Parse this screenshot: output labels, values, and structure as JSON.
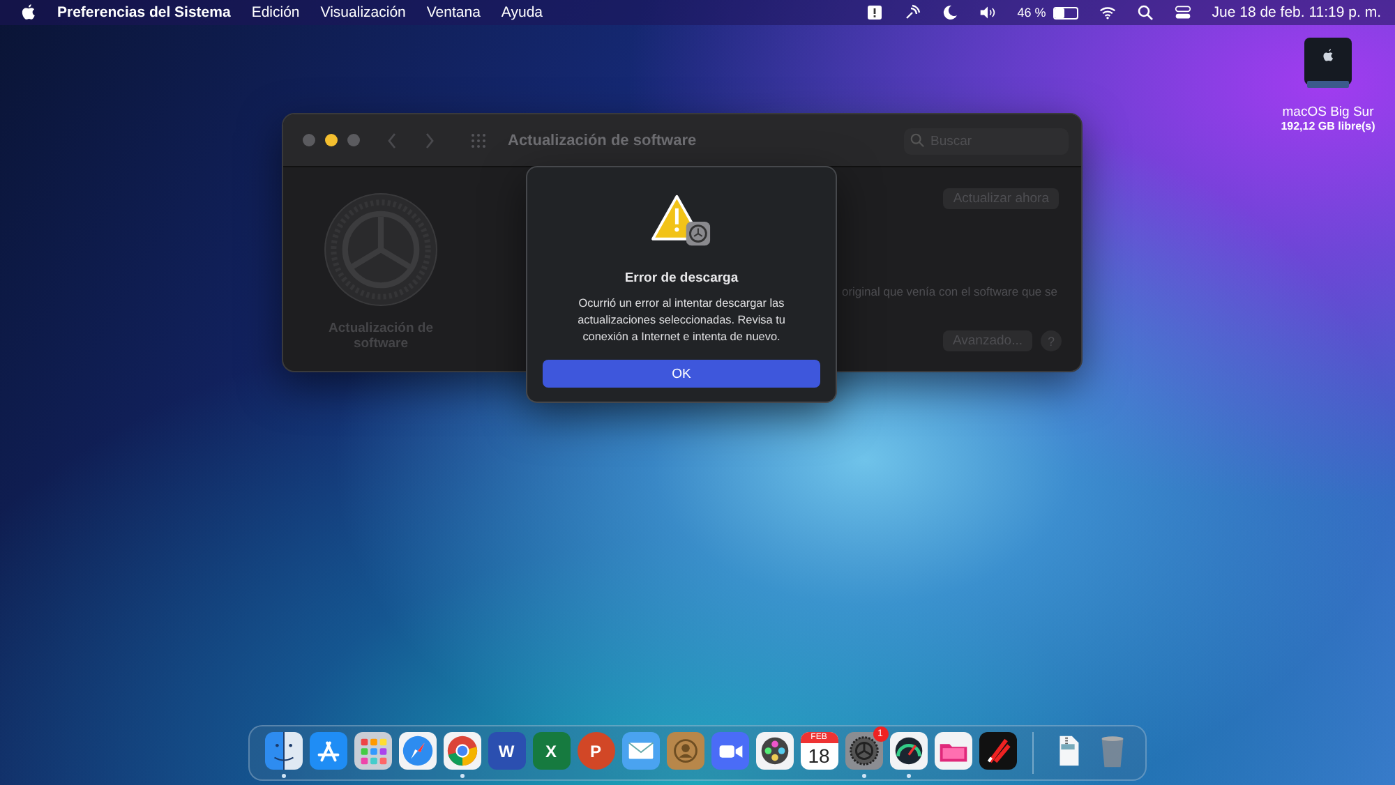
{
  "menu_bar": {
    "app_name": "Preferencias del Sistema",
    "menus": [
      "Edición",
      "Visualización",
      "Ventana",
      "Ayuda"
    ],
    "battery": {
      "reading": "46 %",
      "level": 0.46
    },
    "clock": "Jue 18 de feb.  11:19 p. m."
  },
  "desktop_icon": {
    "name": "macOS Big Sur",
    "detail": "192,12 GB libre(s)"
  },
  "window": {
    "title": "Actualización de software",
    "search": {
      "placeholder": "Buscar"
    },
    "pane_label": "Actualización de software",
    "update_button": "Actualizar ahora",
    "note": "original que venía con el software que se",
    "advanced_button": "Avanzado...",
    "help_button": "?"
  },
  "dialog": {
    "title": "Error de descarga",
    "message": "Ocurrió un error al intentar descargar las actualizaciones seleccionadas. Revisa tu conexión a Internet e intenta de nuevo.",
    "button": "OK"
  },
  "dock": [
    {
      "kind": "finder",
      "running": true
    },
    {
      "kind": "appstore",
      "running": false
    },
    {
      "kind": "launchpad",
      "running": false
    },
    {
      "kind": "safari",
      "running": false
    },
    {
      "kind": "chrome",
      "running": true
    },
    {
      "kind": "word",
      "running": false,
      "label": "W"
    },
    {
      "kind": "excel",
      "running": false,
      "label": "X"
    },
    {
      "kind": "powerpoint",
      "running": false,
      "label": "P"
    },
    {
      "kind": "mail",
      "running": false
    },
    {
      "kind": "contacts",
      "running": false
    },
    {
      "kind": "zoom",
      "running": false
    },
    {
      "kind": "photos",
      "running": false
    },
    {
      "kind": "calendar",
      "running": false,
      "month": "FEB",
      "day": "18"
    },
    {
      "kind": "settings",
      "running": true,
      "badge": "1"
    },
    {
      "kind": "gauge",
      "running": true
    },
    {
      "kind": "folder",
      "running": false
    },
    {
      "kind": "tools",
      "running": false
    },
    {
      "kind": "separator"
    },
    {
      "kind": "archive",
      "running": false
    },
    {
      "kind": "trash",
      "running": false
    }
  ]
}
